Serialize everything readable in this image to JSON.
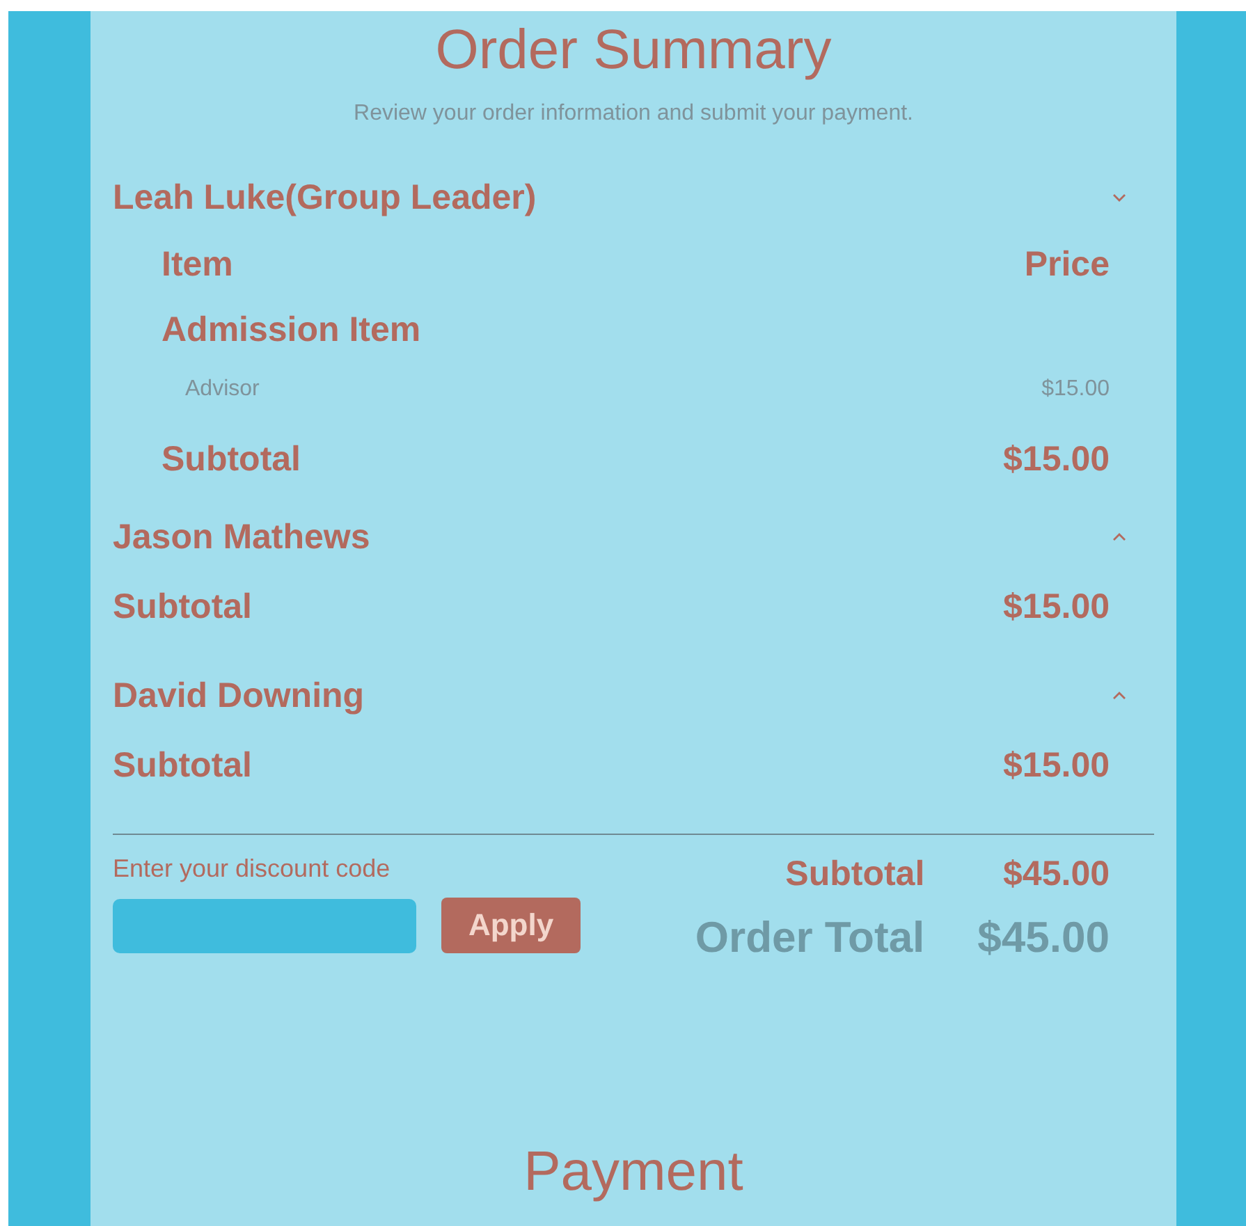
{
  "title": "Order Summary",
  "subtitle": "Review your order information and submit your payment.",
  "groups": [
    {
      "name": "Leah Luke(Group Leader)",
      "expanded": true,
      "columns": {
        "item": "Item",
        "price": "Price"
      },
      "sections": [
        {
          "title": "Admission Item",
          "items": [
            {
              "name": "Advisor",
              "price": "$15.00"
            }
          ]
        }
      ],
      "subtotal_label": "Subtotal",
      "subtotal": "$15.00"
    },
    {
      "name": "Jason Mathews",
      "expanded": false,
      "subtotal_label": "Subtotal",
      "subtotal": "$15.00"
    },
    {
      "name": "David Downing",
      "expanded": false,
      "subtotal_label": "Subtotal",
      "subtotal": "$15.00"
    }
  ],
  "discount": {
    "label": "Enter your discount code",
    "button": "Apply"
  },
  "totals": [
    {
      "kind": "subtotal",
      "label": "Subtotal",
      "value": "$45.00"
    },
    {
      "kind": "total",
      "label": "Order Total",
      "value": "$45.00"
    }
  ],
  "next_heading": "Payment"
}
